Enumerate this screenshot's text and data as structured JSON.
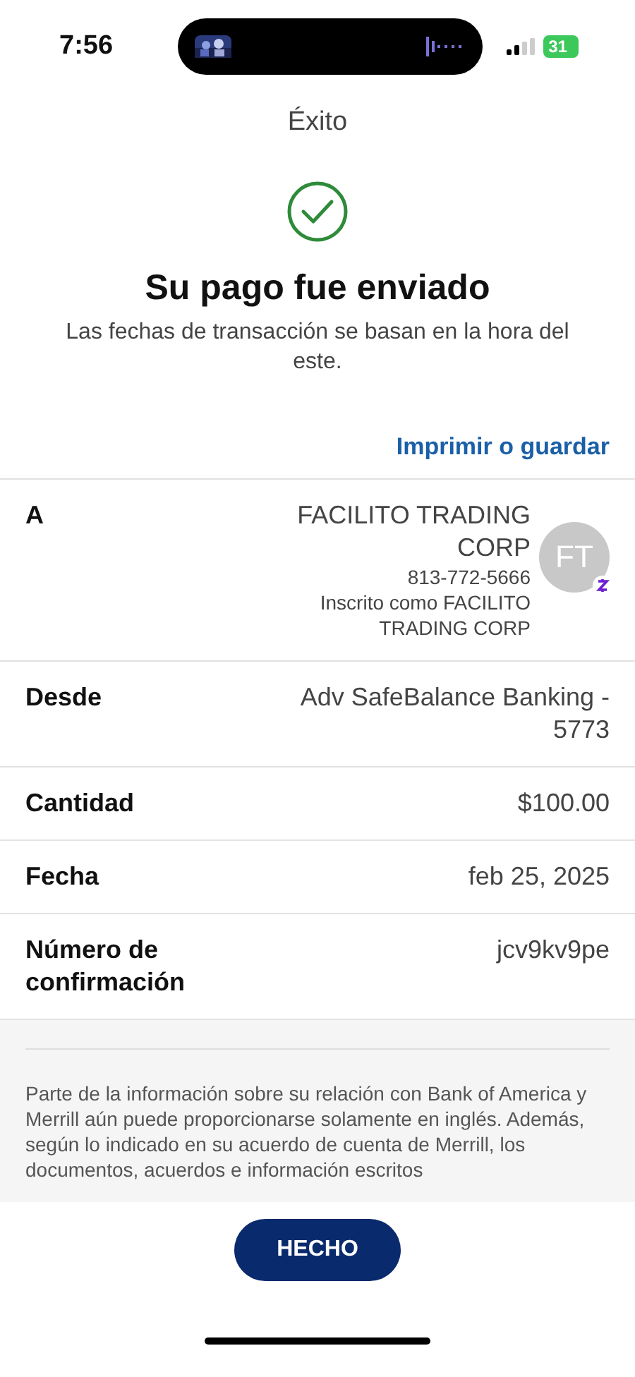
{
  "status_bar": {
    "time": "7:56",
    "battery": "31"
  },
  "header": {
    "title": "Éxito"
  },
  "confirmation": {
    "title": "Su pago fue enviado",
    "subtitle": "Las fechas de transacción se basan en la hora del este."
  },
  "print_link": "Imprimir o guardar",
  "details": [
    {
      "kind": "recipient",
      "label": "A",
      "name": "FACILITO TRADING CORP",
      "phone": "813-772-5666",
      "enrolled": "Inscrito como FACILITO TRADING CORP",
      "initials": "FT"
    },
    {
      "kind": "plain",
      "label": "Desde",
      "value": "Adv SafeBalance Banking - 5773"
    },
    {
      "kind": "plain",
      "label": "Cantidad",
      "value": "$100.00"
    },
    {
      "kind": "plain",
      "label": "Fecha",
      "value": "feb 25, 2025"
    },
    {
      "kind": "plain",
      "label": "Número de confirmación",
      "value": "jcv9kv9pe"
    }
  ],
  "disclaimer": "Parte de la información sobre su relación con Bank of America y Merrill aún puede proporcionarse solamente en inglés. Además, según lo indicado en su acuerdo de cuenta de Merrill, los documentos, acuerdos e información escritos",
  "done_button": "HECHO"
}
